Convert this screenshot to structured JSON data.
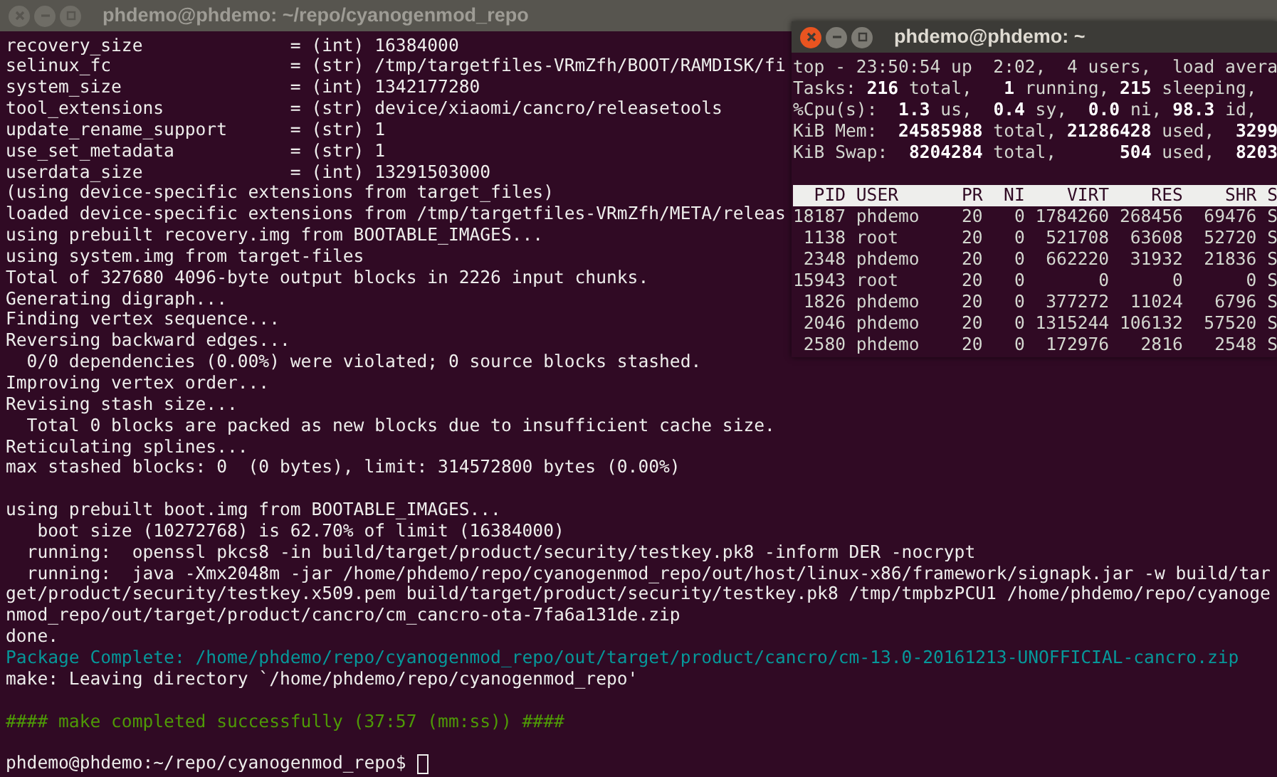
{
  "terminal": {
    "title": "phdemo@phdemo: ~/repo/cyanogenmod_repo",
    "focused": false,
    "lines": [
      {
        "kind": "normal",
        "text": "recovery_size              = (int) 16384000"
      },
      {
        "kind": "normal",
        "text": "selinux_fc                 = (str) /tmp/targetfiles-VRmZfh/BOOT/RAMDISK/fi"
      },
      {
        "kind": "normal",
        "text": "system_size                = (int) 1342177280"
      },
      {
        "kind": "normal",
        "text": "tool_extensions            = (str) device/xiaomi/cancro/releasetools"
      },
      {
        "kind": "normal",
        "text": "update_rename_support      = (str) 1"
      },
      {
        "kind": "normal",
        "text": "use_set_metadata           = (str) 1"
      },
      {
        "kind": "normal",
        "text": "userdata_size              = (int) 13291503000"
      },
      {
        "kind": "normal",
        "text": "(using device-specific extensions from target_files)"
      },
      {
        "kind": "normal",
        "text": "loaded device-specific extensions from /tmp/targetfiles-VRmZfh/META/releas"
      },
      {
        "kind": "normal",
        "text": "using prebuilt recovery.img from BOOTABLE_IMAGES..."
      },
      {
        "kind": "normal",
        "text": "using system.img from target-files"
      },
      {
        "kind": "normal",
        "text": "Total of 327680 4096-byte output blocks in 2226 input chunks."
      },
      {
        "kind": "normal",
        "text": "Generating digraph..."
      },
      {
        "kind": "normal",
        "text": "Finding vertex sequence..."
      },
      {
        "kind": "normal",
        "text": "Reversing backward edges..."
      },
      {
        "kind": "normal",
        "text": "  0/0 dependencies (0.00%) were violated; 0 source blocks stashed."
      },
      {
        "kind": "normal",
        "text": "Improving vertex order..."
      },
      {
        "kind": "normal",
        "text": "Revising stash size..."
      },
      {
        "kind": "normal",
        "text": "  Total 0 blocks are packed as new blocks due to insufficient cache size."
      },
      {
        "kind": "normal",
        "text": "Reticulating splines..."
      },
      {
        "kind": "normal",
        "text": "max stashed blocks: 0  (0 bytes), limit: 314572800 bytes (0.00%)"
      },
      {
        "kind": "blank"
      },
      {
        "kind": "normal",
        "text": "using prebuilt boot.img from BOOTABLE_IMAGES..."
      },
      {
        "kind": "normal",
        "text": "   boot size (10272768) is 62.70% of limit (16384000)"
      },
      {
        "kind": "normal",
        "text": "  running:  openssl pkcs8 -in build/target/product/security/testkey.pk8 -inform DER -nocrypt"
      },
      {
        "kind": "normal",
        "text": "  running:  java -Xmx2048m -jar /home/phdemo/repo/cyanogenmod_repo/out/host/linux-x86/framework/signapk.jar -w build/tar"
      },
      {
        "kind": "normal",
        "text": "get/product/security/testkey.x509.pem build/target/product/security/testkey.pk8 /tmp/tmpbzPCU1 /home/phdemo/repo/cyanoge"
      },
      {
        "kind": "normal",
        "text": "nmod_repo/out/target/product/cancro/cm_cancro-ota-7fa6a131de.zip"
      },
      {
        "kind": "normal",
        "text": "done."
      },
      {
        "kind": "package",
        "text": "Package Complete: /home/phdemo/repo/cyanogenmod_repo/out/target/product/cancro/cm-13.0-20161213-UNOFFICIAL-cancro.zip"
      },
      {
        "kind": "normal",
        "text": "make: Leaving directory `/home/phdemo/repo/cyanogenmod_repo'"
      },
      {
        "kind": "blank"
      },
      {
        "kind": "banner",
        "text": "#### make completed successfully (37:57 (mm:ss)) ####"
      },
      {
        "kind": "blank"
      }
    ],
    "prompt": "phdemo@phdemo:~/repo/cyanogenmod_repo$"
  },
  "top_window": {
    "title": "phdemo@phdemo: ~",
    "focused": true,
    "summary": [
      "top - 23:50:54 up  2:02,  4 users,  load avera",
      "Tasks: **216** total,   **1** running, **215** sleeping,",
      "%Cpu(s):  **1.3** us,  **0.4** sy,  **0.0** ni, **98.3** id,",
      "KiB Mem:  **24585988** total, **21286428** used,  **3299**",
      "KiB Swap:  **8204284** total,      **504** used,  **8203**"
    ],
    "columns": [
      "PID",
      "USER",
      "PR",
      "NI",
      "VIRT",
      "RES",
      "SHR",
      "S"
    ],
    "rows": [
      [
        "18187",
        "phdemo",
        "20",
        "0",
        "1784260",
        "268456",
        "69476",
        "S"
      ],
      [
        "1138",
        "root",
        "20",
        "0",
        "521708",
        "63608",
        "52720",
        "S"
      ],
      [
        "2348",
        "phdemo",
        "20",
        "0",
        "662220",
        "31932",
        "21836",
        "S"
      ],
      [
        "15943",
        "root",
        "20",
        "0",
        "0",
        "0",
        "0",
        "S"
      ],
      [
        "1826",
        "phdemo",
        "20",
        "0",
        "377272",
        "11024",
        "6796",
        "S"
      ],
      [
        "2046",
        "phdemo",
        "20",
        "0",
        "1315244",
        "106132",
        "57520",
        "S"
      ],
      [
        "2580",
        "phdemo",
        "20",
        "0",
        "172976",
        "2816",
        "2548",
        "S"
      ]
    ]
  }
}
